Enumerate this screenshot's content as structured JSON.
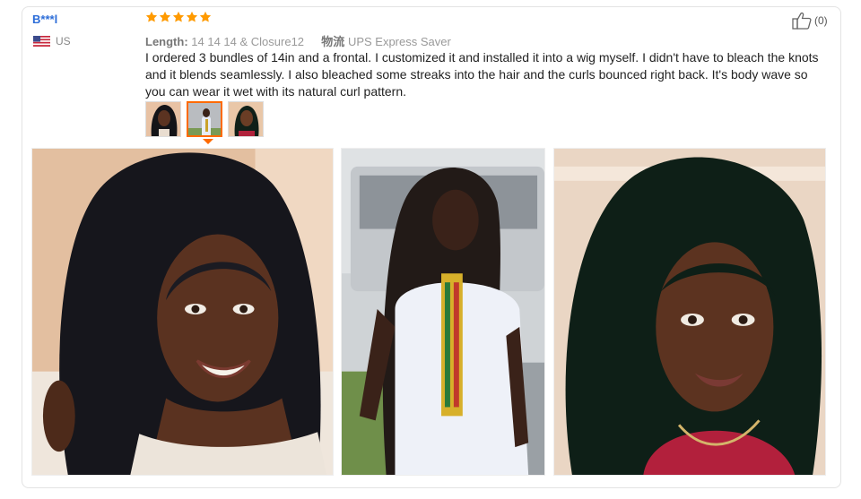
{
  "review": {
    "username": "B***l",
    "country_code": "US",
    "rating": 5,
    "star_color": "#ff9a00",
    "meta": {
      "length_label": "Length:",
      "length_value": "14 14 14 & Closure12",
      "shipping_label": "物流",
      "shipping_value": "UPS Express Saver"
    },
    "text": "I ordered 3 bundles of 14in and a frontal. I customized it and installed it into a wig myself. I didn't have to bleach the knots and it blends seamlessly. I also bleached some streaks into the hair and the curls bounced right back. It's body wave so you can wear it wet with its natural curl pattern.",
    "helpful_count": "(0)",
    "thumbnails_active_index": 1,
    "accent_color": "#ff6a00"
  },
  "icons": {
    "flag": "us-flag-icon",
    "star": "star-icon",
    "helpful": "thumbs-up-icon"
  }
}
